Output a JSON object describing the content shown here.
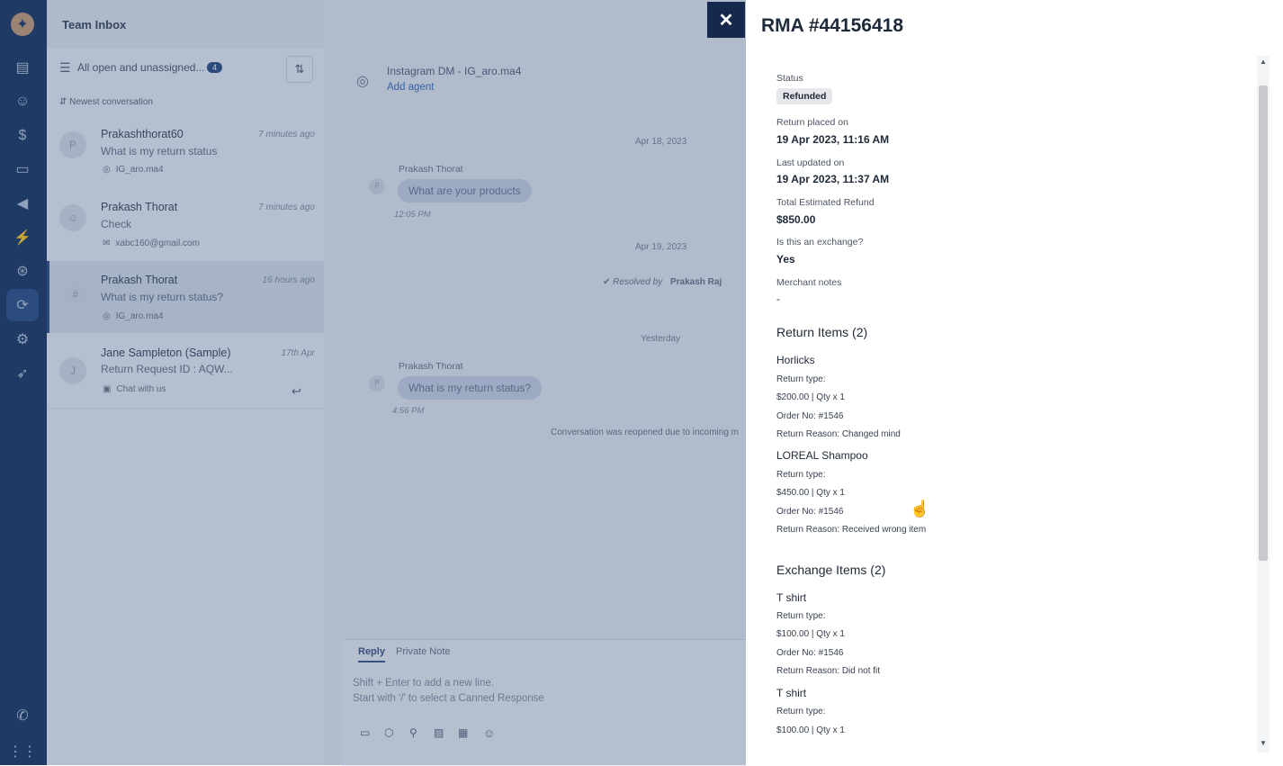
{
  "colors": {
    "rail": "#1d3a66",
    "accent": "#14294b",
    "overlay": "#1e3a66"
  },
  "header": {
    "title": "Team Inbox"
  },
  "list": {
    "filter_label": "All open and unassigned...",
    "filter_count": "4",
    "sort_label": "Newest conversation",
    "items": [
      {
        "avatar": "P",
        "name": "Prakashthorat60",
        "time": "7 minutes ago",
        "message": "What is my return status",
        "channel": "IG_aro.ma4",
        "channel_icon": "instagram-icon"
      },
      {
        "avatar": "",
        "name": "Prakash Thorat",
        "time": "7 minutes ago",
        "message": "Check",
        "channel": "xabc160@gmail.com",
        "channel_icon": "email-icon"
      },
      {
        "avatar": "#",
        "name": "Prakash Thorat",
        "time": "16 hours ago",
        "message": "What is my return status?",
        "channel": "IG_aro.ma4",
        "channel_icon": "instagram-icon"
      },
      {
        "avatar": "J",
        "name": "Jane Sampleton (Sample)",
        "time": "17th Apr",
        "message": "Return Request ID : AQW...",
        "channel": "Chat with us",
        "channel_icon": "chat-icon"
      }
    ]
  },
  "chat": {
    "channel_title": "Instagram DM - IG_aro.ma4",
    "add_agent": "Add agent",
    "date1": "Apr 18, 2023",
    "sender1": "Prakash Thorat",
    "msg1": "What are your products",
    "time1": "12:05 PM",
    "date2": "Apr 19, 2023",
    "resolved_by": "Resolved by",
    "resolver": "Prakash Raj",
    "date3": "Yesterday",
    "sender2": "Prakash Thorat",
    "msg2": "What is my return status?",
    "time2": "4:56 PM",
    "system_msg": "Conversation was reopened due to incoming m",
    "tab_reply": "Reply",
    "tab_note": "Private Note",
    "composer_hint1": "Shift + Enter to add a new line.",
    "composer_hint2": "Start with '/' to select a Canned Response"
  },
  "drawer": {
    "title": "RMA #44156418",
    "status_label": "Status",
    "status_value": "Refunded",
    "placed_label": "Return placed on",
    "placed_value": "19 Apr 2023, 11:16 AM",
    "updated_label": "Last updated on",
    "updated_value": "19 Apr 2023, 11:37 AM",
    "refund_label": "Total Estimated Refund",
    "refund_value": "$850.00",
    "exchange_label": "Is this an exchange?",
    "exchange_value": "Yes",
    "notes_label": "Merchant notes",
    "notes_value": "-",
    "return_items_title": "Return Items (2)",
    "return_items": [
      {
        "name": "Horlicks",
        "type": "Return type:",
        "price": "$200.00 | Qty x 1",
        "order": "Order No: #1546",
        "reason": "Return Reason: Changed mind"
      },
      {
        "name": "LOREAL Shampoo",
        "type": "Return type:",
        "price": "$450.00 | Qty x 1",
        "order": "Order No: #1546",
        "reason": "Return Reason: Received wrong item"
      }
    ],
    "exchange_items_title": "Exchange Items (2)",
    "exchange_items": [
      {
        "name": "T shirt",
        "type": "Return type:",
        "price": "$100.00 | Qty x 1",
        "order": "Order No: #1546",
        "reason": "Return Reason: Did not fit"
      },
      {
        "name": "T shirt",
        "type": "Return type:",
        "price": "$100.00 | Qty x 1"
      }
    ]
  }
}
